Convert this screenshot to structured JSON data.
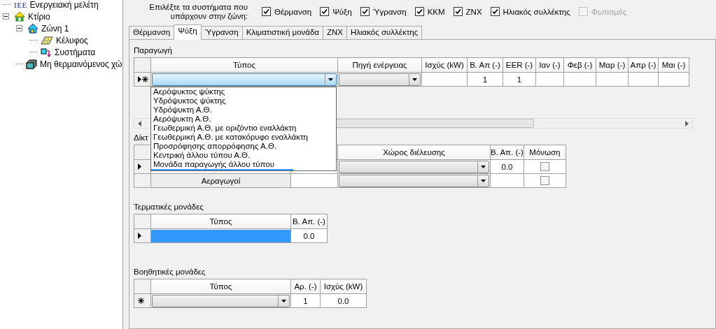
{
  "tree": [
    {
      "label": "Ενεργειακή μελέτη",
      "kind": "study",
      "logo": "ΙΕΕ"
    },
    {
      "label": "Κτίριο",
      "kind": "building",
      "expanded": true,
      "children": [
        {
          "label": "Ζώνη 1",
          "kind": "zone",
          "expanded": true,
          "children": [
            {
              "label": "Κέλυφος",
              "kind": "envelope"
            },
            {
              "label": "Συστήματα",
              "kind": "systems"
            }
          ]
        },
        {
          "label": "Μη θερμαινόμενος χώ",
          "kind": "unheated"
        }
      ]
    }
  ],
  "systems_prompt": "Επιλέξτε τα συστήματα που\nυπάρχουν στην ζώνη:",
  "systems": [
    {
      "label": "Θέρμανση",
      "checked": true,
      "disabled": false
    },
    {
      "label": "Ψύξη",
      "checked": true,
      "disabled": false
    },
    {
      "label": "Ύγρανση",
      "checked": true,
      "disabled": false
    },
    {
      "label": "ΚΚΜ",
      "checked": true,
      "disabled": false
    },
    {
      "label": "ZNX",
      "checked": true,
      "disabled": false
    },
    {
      "label": "Ηλιακός συλλέκτης",
      "checked": true,
      "disabled": false
    },
    {
      "label": "Φωτισμός",
      "checked": false,
      "disabled": true
    }
  ],
  "tabs": [
    {
      "label": "Θέρμανση",
      "selected": false
    },
    {
      "label": "Ψύξη",
      "selected": true
    },
    {
      "label": "Ύγρανση",
      "selected": false
    },
    {
      "label": "Κλιματιστική μονάδα",
      "selected": false
    },
    {
      "label": "ZNX",
      "selected": false
    },
    {
      "label": "Ηλιακός συλλέκτης",
      "selected": false
    }
  ],
  "grids": [
    {
      "title": "Παραγωγή",
      "columns": [
        {
          "label": "Τύπος"
        },
        {
          "label": "Πηγή ενέργειας"
        },
        {
          "label": "Ισχύς (kW)"
        },
        {
          "label": "Β. Απ (-)"
        },
        {
          "label": "EER (-)"
        },
        {
          "label": "Ιαν (-)"
        },
        {
          "label": "Φεβ (-)"
        },
        {
          "label": "Μαρ (-)"
        },
        {
          "label": "Απρ (-)"
        },
        {
          "label": "Μαι (-)"
        }
      ],
      "rows": [
        {
          "current": true,
          "new": true,
          "cells": [
            {
              "kind": "combo_focused"
            },
            {
              "kind": "combo"
            },
            {
              "kind": "text"
            },
            {
              "kind": "text",
              "value": "1"
            },
            {
              "kind": "text",
              "value": "1"
            },
            {
              "kind": "text"
            },
            {
              "kind": "text"
            },
            {
              "kind": "text"
            },
            {
              "kind": "text"
            },
            {
              "kind": "text"
            }
          ]
        }
      ],
      "dropdown": {
        "options": [
          {
            "label": "Αερόψυκτος ψύκτης",
            "selected": false
          },
          {
            "label": "Υδρόψυκτος ψύκτης",
            "selected": false
          },
          {
            "label": "Υδρόψυκτη Α.Θ.",
            "selected": false
          },
          {
            "label": "Αερόψυκτη Α.Θ.",
            "selected": false
          },
          {
            "label": "Γεωθερμική Α.Θ. με οριζόντιο εναλλάκτη",
            "selected": false
          },
          {
            "label": "Γεωθερμική Α.Θ. με κατακόρυφο εναλλάκτη",
            "selected": false
          },
          {
            "label": "Προσρόφησης απορρόφησης Α.Θ.",
            "selected": false
          },
          {
            "label": "Κεντρική άλλου τύπου Α.Θ.",
            "selected": false
          },
          {
            "label": "Μονάδα παραγωγής άλλου τύπου",
            "selected": false
          },
          {
            "selected": true
          }
        ]
      }
    },
    {
      "title": "Δίκτ",
      "columns": [
        {},
        {},
        {
          "label": "Χώρος διέλευσης"
        },
        {
          "label": "Β. Απ. (-)"
        },
        {
          "label": "Μόνωση"
        }
      ],
      "rows": [
        {
          "current": true,
          "new": false,
          "cells": [
            {
              "kind": "text"
            },
            {
              "kind": "text"
            },
            {
              "kind": "combo"
            },
            {
              "kind": "text",
              "value": "0.0"
            },
            {
              "kind": "checkbox",
              "checked": false
            }
          ]
        },
        {
          "current": false,
          "new": false,
          "cells": [
            {
              "kind": "button",
              "value": "Αεραγωγοί"
            },
            {
              "kind": "text"
            },
            {
              "kind": "combo"
            },
            {
              "kind": "text"
            },
            {
              "kind": "checkbox",
              "checked": false
            }
          ]
        }
      ]
    },
    {
      "title": "Τερματικές μονάδες",
      "columns": [
        {
          "label": "Τύπος"
        },
        {
          "label": "Β. Απ. (-)"
        }
      ],
      "rows": [
        {
          "current": true,
          "new": false,
          "cells": [
            {
              "kind": "text",
              "selected": true
            },
            {
              "kind": "text",
              "value": "0.0"
            }
          ]
        }
      ]
    },
    {
      "title": "Βοηθητικές μονάδες",
      "columns": [
        {
          "label": "Τύπος"
        },
        {
          "label": "Αρ. (-)"
        },
        {
          "label": "Ισχύς (kW)"
        }
      ],
      "rows": [
        {
          "current": false,
          "new": true,
          "cells": [
            {
              "kind": "combo"
            },
            {
              "kind": "text",
              "value": "1"
            },
            {
              "kind": "text",
              "value": "0.0"
            }
          ]
        }
      ]
    }
  ]
}
